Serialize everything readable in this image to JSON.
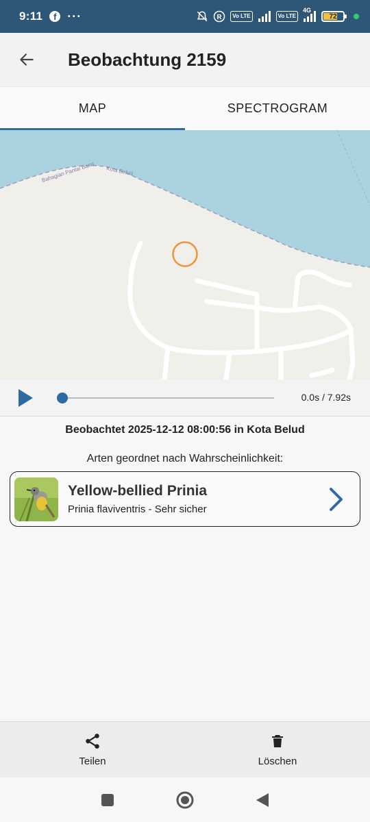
{
  "status_bar": {
    "time": "9:11",
    "dots": "···",
    "tag1": "Vo LTE",
    "tag2": "Vo LTE",
    "network": "4G",
    "battery": "72"
  },
  "app_bar": {
    "title": "Beobachtung 2159"
  },
  "tabs": [
    {
      "label": "MAP",
      "active": true
    },
    {
      "label": "SPECTROGRAM",
      "active": false
    }
  ],
  "map": {
    "labels": [
      "Bahagian Pantai Barat",
      "Kota Belud"
    ]
  },
  "player": {
    "time": "0.0s / 7.92s",
    "progress_fraction": 0.0
  },
  "observed_text": "Beobachtet 2025-12-12 08:00:56 in Kota Belud",
  "species_heading": "Arten geordnet nach Wahrscheinlichkeit:",
  "species": [
    {
      "common_name": "Yellow-bellied Prinia",
      "detail": "Prinia flaviventris - Sehr sicher"
    }
  ],
  "actions": {
    "share_label": "Teilen",
    "delete_label": "Löschen"
  },
  "colors": {
    "status_bar": "#2e5677",
    "accent": "#2e6aa3",
    "water": "#aad3df",
    "land": "#f0efe9",
    "marker": "#f0933a"
  }
}
